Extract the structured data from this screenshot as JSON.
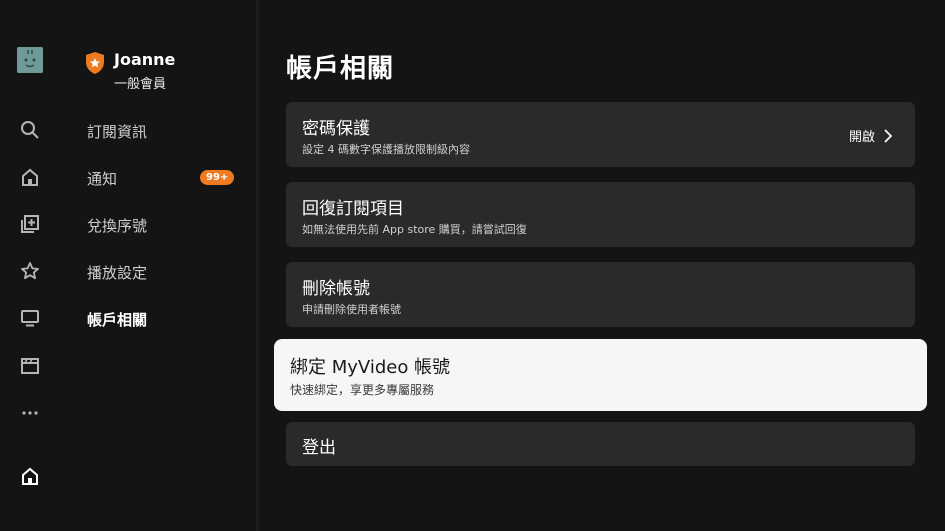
{
  "rail": {
    "icons": [
      "avatar-icon",
      "search-icon",
      "home-icon",
      "add-library-icon",
      "star-icon",
      "tv-icon",
      "clapperboard-icon",
      "more-icon",
      "home-small-icon"
    ]
  },
  "user": {
    "name": "Joanne",
    "tier": "一般會員"
  },
  "menu": {
    "items": [
      {
        "label": "訂閱資訊"
      },
      {
        "label": "通知",
        "badge": "99+"
      },
      {
        "label": "兌換序號"
      },
      {
        "label": "播放設定"
      },
      {
        "label": "帳戶相關"
      }
    ]
  },
  "page": {
    "title": "帳戶相關"
  },
  "cards": [
    {
      "title": "密碼保護",
      "desc": "設定 4 碼數字保護播放限制級內容",
      "action": "開啟"
    },
    {
      "title": "回復訂閱項目",
      "desc": "如無法使用先前 App store 購買，請嘗試回復"
    },
    {
      "title": "刪除帳號",
      "desc": "申請刪除使用者帳號"
    },
    {
      "title": "綁定 MyVideo 帳號",
      "desc": "快速綁定，享更多專屬服務"
    },
    {
      "title": "登出"
    }
  ],
  "colors": {
    "background": "#141414",
    "card": "#2a2a2a",
    "focused_card": "#f6f6f6",
    "badge": "#ee7b21",
    "shield": "#ee7b21"
  }
}
